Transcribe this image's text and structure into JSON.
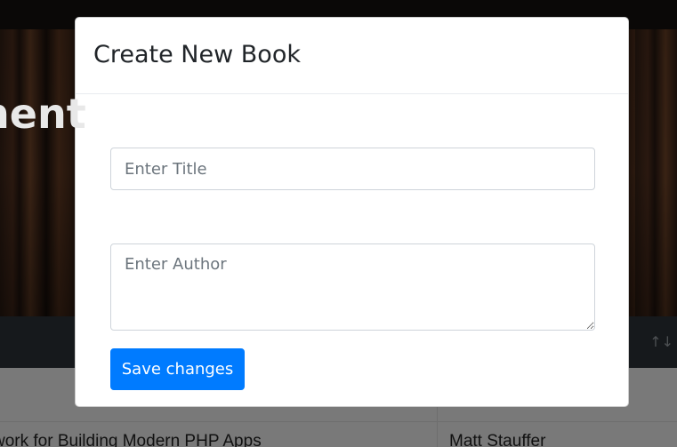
{
  "background": {
    "hero_title": "nent",
    "table": {
      "sort_icon": "↑↓",
      "rows": [
        {
          "title": "work for Building Modern PHP Apps",
          "author": "Matt Stauffer"
        }
      ]
    }
  },
  "modal": {
    "title": "Create New Book",
    "title_field": {
      "placeholder": "Enter Title",
      "value": ""
    },
    "author_field": {
      "placeholder": "Enter Author",
      "value": ""
    },
    "save_label": "Save changes"
  },
  "colors": {
    "primary": "#007bff",
    "table_header": "#2d3339",
    "backdrop": "rgba(0,0,0,0.5)"
  }
}
